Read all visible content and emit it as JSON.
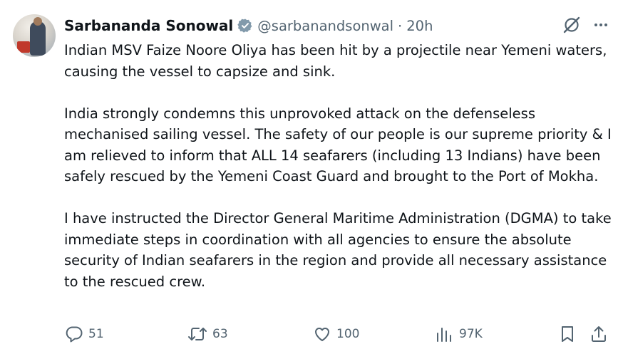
{
  "tweet": {
    "author_name": "Sarbananda Sonowal",
    "handle": "@sarbanandsonwal",
    "separator": "·",
    "time": "20h",
    "paragraphs": [
      "Indian MSV Faize Noore Oliya has been hit by a projectile near Yemeni waters, causing the vessel to capsize and sink.",
      "India strongly condemns this unprovoked attack on the defenseless mechanised sailing vessel. The safety of our people is our supreme priority & I am relieved to inform that ALL 14 seafarers (including 13 Indians) have been safely rescued by the Yemeni Coast Guard and brought to the Port of Mokha.",
      "I have instructed the Director General Maritime Administration (DGMA) to take immediate steps in coordination with all agencies to ensure the absolute security of Indian seafarers in the region and provide all necessary assistance to the rescued crew."
    ],
    "metrics": {
      "replies": "51",
      "reposts": "63",
      "likes": "100",
      "views": "97K"
    }
  },
  "icons": {
    "verified": "verified-badge-icon",
    "grok": "grok-icon",
    "more": "more-icon",
    "reply": "reply-icon",
    "repost": "repost-icon",
    "like": "like-icon",
    "views": "views-icon",
    "bookmark": "bookmark-icon",
    "share": "share-icon"
  },
  "colors": {
    "text_primary": "#0f1419",
    "text_secondary": "#536471",
    "verified_badge": "#829aab"
  }
}
